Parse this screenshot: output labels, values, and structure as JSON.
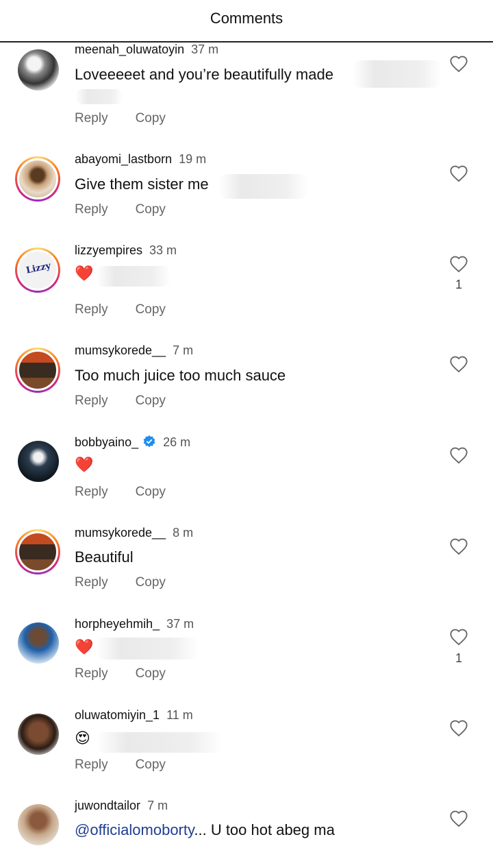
{
  "header": {
    "title": "Comments"
  },
  "actions": {
    "reply": "Reply",
    "copy": "Copy"
  },
  "comments": [
    {
      "username": "meenah_oluwatoyin",
      "time": "37 m",
      "text": "Loveeeeet and you’re beautifully made",
      "likes": "",
      "avatar": "photo-grayscale"
    },
    {
      "username": "abayomi_lastborn",
      "time": "19 m",
      "text": "Give them sister me",
      "likes": "",
      "avatar": "photo-man-traditional"
    },
    {
      "username": "lizzyempires",
      "time": "33 m",
      "text": "❤️",
      "likes": "1",
      "avatar": "logo-lizzy"
    },
    {
      "username": "mumsykorede__",
      "time": "7 m",
      "text": "Too much juice too much sauce",
      "likes": "",
      "avatar": "photo-doorway"
    },
    {
      "username": "bobbyaino_",
      "time": "26 m",
      "text": "❤️",
      "likes": "",
      "verified": true,
      "avatar": "photo-man-dark"
    },
    {
      "username": "mumsykorede__",
      "time": "8 m",
      "text": "Beautiful",
      "likes": "",
      "avatar": "photo-doorway"
    },
    {
      "username": "horpheyehmih_",
      "time": "37 m",
      "text": "❤️",
      "likes": "1",
      "avatar": "photo-woman-blue"
    },
    {
      "username": "oluwatomiyin_1",
      "time": "11 m",
      "text": "😍",
      "likes": "",
      "avatar": "photo-woman"
    },
    {
      "username": "juwondtailor",
      "time": "7 m",
      "mention": "@officialomoborty",
      "text": "... U too hot abeg ma",
      "likes": "",
      "avatar": "photo-man-cap"
    }
  ],
  "colors": {
    "heart": "#e0142d",
    "mention": "#1f3f8f",
    "verified": "#1d8cf0"
  },
  "icons": {
    "like": "heart-outline-icon",
    "verified": "verified-badge-icon"
  }
}
